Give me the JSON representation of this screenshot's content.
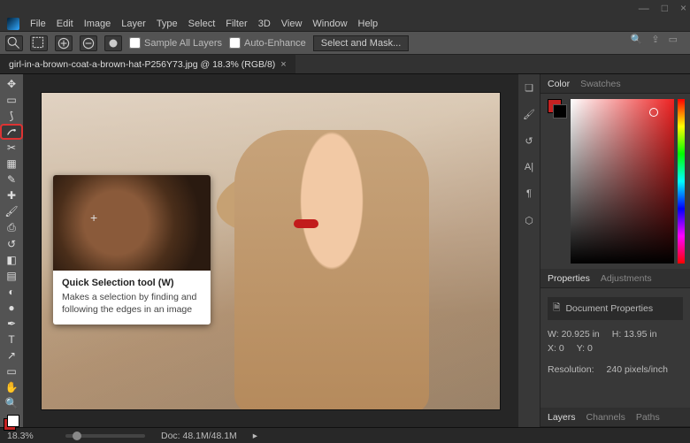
{
  "window": {
    "min": "—",
    "max": "□",
    "close": "×"
  },
  "menu": [
    "File",
    "Edit",
    "Image",
    "Layer",
    "Type",
    "Select",
    "Filter",
    "3D",
    "View",
    "Window",
    "Help"
  ],
  "options": {
    "sample_all_label": "Sample All Layers",
    "auto_enhance_label": "Auto-Enhance",
    "select_mask_label": "Select and Mask..."
  },
  "tab": {
    "label": "girl-in-a-brown-coat-a-brown-hat-P256Y73.jpg @ 18.3% (RGB/8)",
    "close": "×"
  },
  "tooltip": {
    "title": "Quick Selection tool (W)",
    "desc": "Makes a selection by finding and following the edges in an image"
  },
  "panels": {
    "color_tab": "Color",
    "swatches_tab": "Swatches",
    "properties_tab": "Properties",
    "adjustments_tab": "Adjustments",
    "doc_props": "Document Properties",
    "w_label": "W:",
    "w_val": "20.925 in",
    "h_label": "H:",
    "h_val": "13.95 in",
    "x_label": "X:",
    "x_val": "0",
    "y_label": "Y:",
    "y_val": "0",
    "res_label": "Resolution:",
    "res_val": "240 pixels/inch",
    "layers_tab": "Layers",
    "channels_tab": "Channels",
    "paths_tab": "Paths"
  },
  "status": {
    "zoom": "18.3%",
    "doc": "Doc: 48.1M/48.1M"
  }
}
